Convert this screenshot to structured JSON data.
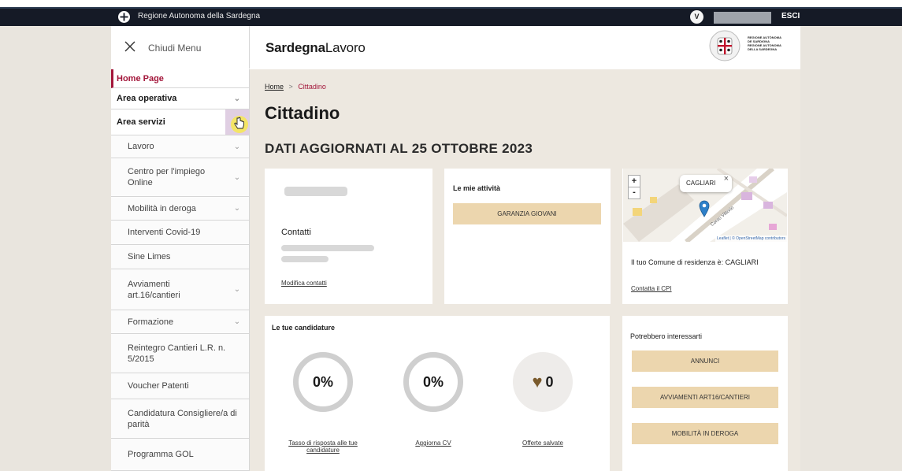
{
  "topbar": {
    "region": "Regione Autonoma della Sardegna",
    "avatar_initial": "V",
    "logout": "ESCI"
  },
  "menu": {
    "close_label": "Chiudi Menu"
  },
  "header": {
    "brand_bold": "Sardegna",
    "brand_regular": "Lavoro",
    "crest_text": "REGIONE AUTÒNOMA DE SARDIGNA REGIONE AUTONOMA DELLA SARDEGNA"
  },
  "sidebar": {
    "items": [
      {
        "label": "Home Page"
      },
      {
        "label": "Area operativa"
      },
      {
        "label": "Area servizi"
      },
      {
        "label": "Lavoro"
      },
      {
        "label": "Centro per l'impiego Online"
      },
      {
        "label": "Mobilità in deroga"
      },
      {
        "label": "Interventi Covid-19"
      },
      {
        "label": "Sine Limes"
      },
      {
        "label": "Avviamenti art.16/cantieri"
      },
      {
        "label": "Formazione"
      },
      {
        "label": "Reintegro Cantieri L.R. n. 5/2015"
      },
      {
        "label": "Voucher Patenti"
      },
      {
        "label": "Candidatura Consigliere/a di parità"
      },
      {
        "label": "Programma GOL"
      }
    ]
  },
  "breadcrumb": {
    "home": "Home",
    "separator": ">",
    "current": "Cittadino"
  },
  "page": {
    "title": "Cittadino",
    "date_title": "DATI AGGIORNATI AL 25 OTTOBRE 2023"
  },
  "profile_card": {
    "contacts_label": "Contatti",
    "edit_link": "Modifica contatti"
  },
  "activities_card": {
    "title": "Le mie attività",
    "button": "GARANZIA GIOVANI"
  },
  "map_card": {
    "city_label": "CAGLIARI",
    "street_label": "Corso Vittorio",
    "attribution": "Leaflet | © OpenStreetMap contributors",
    "zoom_in": "+",
    "zoom_out": "-",
    "close": "×",
    "residence_text": "Il tuo Comune di residenza è: CAGLIARI",
    "contact_link": "Contatta il CPI"
  },
  "applications_card": {
    "title": "Le tue candidature",
    "stats": [
      {
        "value": "0%",
        "link": "Tasso di risposta alle tue candidature"
      },
      {
        "value": "0%",
        "link": "Aggiorna CV"
      },
      {
        "value": "0",
        "link": "Offerte salvate"
      }
    ]
  },
  "interests_card": {
    "title": "Potrebbero interessarti",
    "buttons": [
      "ANNUNCI",
      "AVVIAMENTI ART16/CANTIERI",
      "MOBILITÀ IN DEROGA"
    ]
  },
  "colors": {
    "accent": "#a3163a",
    "topbar": "#151a26",
    "button_tan": "#ecd6ae",
    "content_bg": "#ede8e0"
  }
}
